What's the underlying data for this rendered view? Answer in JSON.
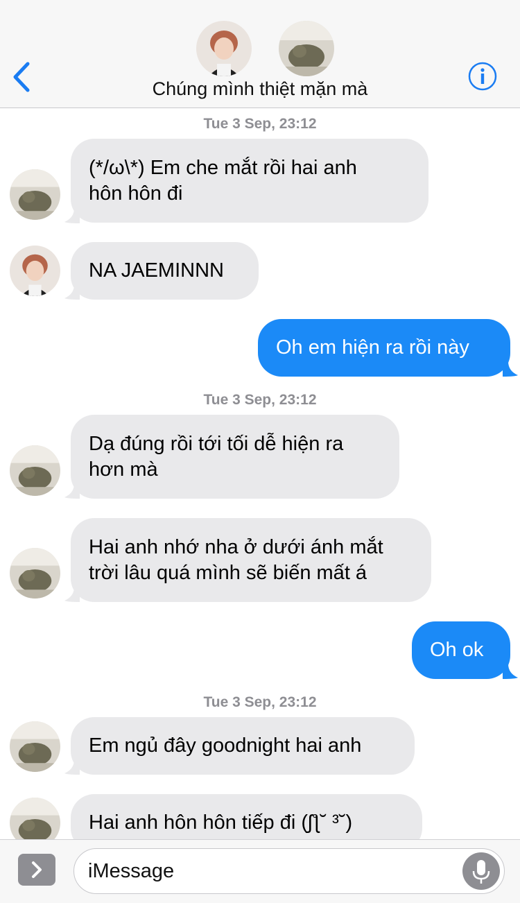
{
  "header": {
    "title": "Chúng mình thiệt mặn mà",
    "back_icon": "chevron-left-icon",
    "info_icon": "info-icon",
    "accent": "#1a7cf2"
  },
  "timestamps": [
    "Tue 3 Sep, 23:12",
    "Tue 3 Sep, 23:12",
    "Tue 3 Sep, 23:12"
  ],
  "messages": [
    {
      "from": "cat",
      "text_lines": [
        "(*/ω\\*) Em che mắt rồi hai anh",
        "hôn hôn đi"
      ]
    },
    {
      "from": "boy",
      "text_lines": [
        "NA JAEMINNN"
      ]
    },
    {
      "from": "me",
      "text_lines": [
        "Oh em hiện ra rồi này"
      ]
    },
    {
      "from": "cat",
      "text_lines": [
        "Dạ đúng rồi tới tối dễ hiện ra",
        "hơn mà"
      ]
    },
    {
      "from": "cat",
      "text_lines": [
        "Hai anh nhớ nha ở dưới ánh mắt",
        "trời lâu quá mình sẽ biến mất á"
      ]
    },
    {
      "from": "me",
      "text_lines": [
        "Oh ok"
      ]
    },
    {
      "from": "cat",
      "text_lines": [
        "Em ngủ đây goodnight hai anh"
      ]
    },
    {
      "from": "cat",
      "text_lines": [
        "Hai anh hôn hôn tiếp đi (ʃƪ˘ ³˘)"
      ]
    }
  ],
  "input": {
    "placeholder": "iMessage",
    "app_icon": "chevron-right-icon",
    "mic_icon": "microphone-icon"
  },
  "colors": {
    "incoming_bubble": "#e9e9eb",
    "outgoing_bubble": "#1b8af7",
    "timestamp": "#8e8e93"
  }
}
